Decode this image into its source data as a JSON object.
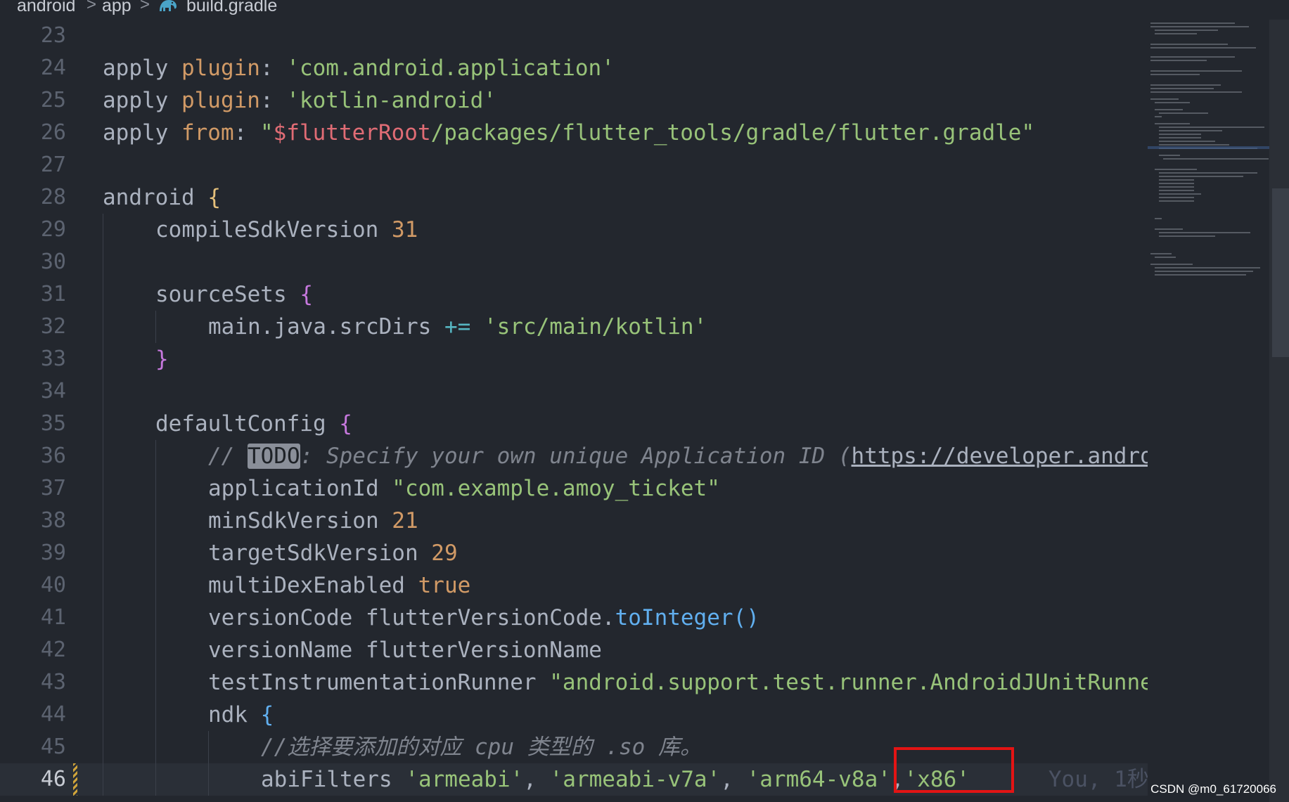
{
  "breadcrumb": {
    "items": [
      "android",
      "app",
      "build.gradle"
    ],
    "separator": ">"
  },
  "editor": {
    "lines": [
      {
        "n": "23"
      },
      {
        "n": "24",
        "indent": 0,
        "tokens": [
          [
            "fn",
            "apply "
          ],
          [
            "kw",
            "plugin"
          ],
          [
            "fn",
            ": "
          ],
          [
            "str",
            "'com.android.application'"
          ]
        ]
      },
      {
        "n": "25",
        "indent": 0,
        "tokens": [
          [
            "fn",
            "apply "
          ],
          [
            "kw",
            "plugin"
          ],
          [
            "fn",
            ": "
          ],
          [
            "str",
            "'kotlin-android'"
          ]
        ]
      },
      {
        "n": "26",
        "indent": 0,
        "tokens": [
          [
            "fn",
            "apply "
          ],
          [
            "kw",
            "from"
          ],
          [
            "fn",
            ": "
          ],
          [
            "str",
            "\""
          ],
          [
            "var",
            "$flutterRoot"
          ],
          [
            "str",
            "/packages/flutter_tools/gradle/flutter.gradle\""
          ]
        ]
      },
      {
        "n": "27"
      },
      {
        "n": "28",
        "indent": 0,
        "tokens": [
          [
            "fn",
            "android "
          ],
          [
            "brace-y",
            "{"
          ]
        ]
      },
      {
        "n": "29",
        "indent": 1,
        "tokens": [
          [
            "fn",
            "compileSdkVersion "
          ],
          [
            "num",
            "31"
          ]
        ]
      },
      {
        "n": "30"
      },
      {
        "n": "31",
        "indent": 1,
        "tokens": [
          [
            "fn",
            "sourceSets "
          ],
          [
            "brace-p",
            "{"
          ]
        ]
      },
      {
        "n": "32",
        "indent": 2,
        "tokens": [
          [
            "fn",
            "main.java.srcDirs "
          ],
          [
            "op",
            "+="
          ],
          [
            "fn",
            " "
          ],
          [
            "str",
            "'src/main/kotlin'"
          ]
        ]
      },
      {
        "n": "33",
        "indent": 1,
        "tokens": [
          [
            "brace-p",
            "}"
          ]
        ]
      },
      {
        "n": "34"
      },
      {
        "n": "35",
        "indent": 1,
        "tokens": [
          [
            "fn",
            "defaultConfig "
          ],
          [
            "brace-p",
            "{"
          ]
        ]
      },
      {
        "n": "36",
        "indent": 2,
        "tokens": [
          [
            "cm",
            "// "
          ],
          [
            "todo",
            "TODO"
          ],
          [
            "cm",
            ": Specify your own unique Application ID ("
          ],
          [
            "url",
            "https://developer.andro"
          ]
        ]
      },
      {
        "n": "37",
        "indent": 2,
        "tokens": [
          [
            "fn",
            "applicationId "
          ],
          [
            "str",
            "\"com.example.amoy_ticket\""
          ]
        ]
      },
      {
        "n": "38",
        "indent": 2,
        "tokens": [
          [
            "fn",
            "minSdkVersion "
          ],
          [
            "num",
            "21"
          ]
        ]
      },
      {
        "n": "39",
        "indent": 2,
        "tokens": [
          [
            "fn",
            "targetSdkVersion "
          ],
          [
            "num",
            "29"
          ]
        ]
      },
      {
        "n": "40",
        "indent": 2,
        "tokens": [
          [
            "fn",
            "multiDexEnabled "
          ],
          [
            "kw",
            "true"
          ]
        ]
      },
      {
        "n": "41",
        "indent": 2,
        "tokens": [
          [
            "fn",
            "versionCode flutterVersionCode."
          ],
          [
            "meth",
            "toInteger"
          ],
          [
            "brace-b",
            "()"
          ]
        ]
      },
      {
        "n": "42",
        "indent": 2,
        "tokens": [
          [
            "fn",
            "versionName flutterVersionName"
          ]
        ]
      },
      {
        "n": "43",
        "indent": 2,
        "tokens": [
          [
            "fn",
            "testInstrumentationRunner "
          ],
          [
            "str",
            "\"android.support.test.runner.AndroidJUnitRunner\""
          ]
        ]
      },
      {
        "n": "44",
        "indent": 2,
        "tokens": [
          [
            "fn",
            "ndk "
          ],
          [
            "brace-b",
            "{"
          ]
        ]
      },
      {
        "n": "45",
        "indent": 3,
        "tokens": [
          [
            "cm",
            "//选择要添加的对应 cpu 类型的 .so 库。"
          ]
        ]
      },
      {
        "n": "46",
        "indent": 3,
        "current": true,
        "tokens": [
          [
            "fn",
            "abiFilters "
          ],
          [
            "str",
            "'armeabi'"
          ],
          [
            "fn",
            ", "
          ],
          [
            "str",
            "'armeabi-v7a'"
          ],
          [
            "fn",
            ", "
          ],
          [
            "str",
            "'arm64-v8a'"
          ],
          [
            "fn",
            ","
          ],
          [
            "str",
            "'x86'"
          ],
          [
            "fn",
            "      "
          ],
          [
            "blame",
            "You, 1秒"
          ]
        ]
      }
    ]
  },
  "watermark": "CSDN @m0_61720066"
}
